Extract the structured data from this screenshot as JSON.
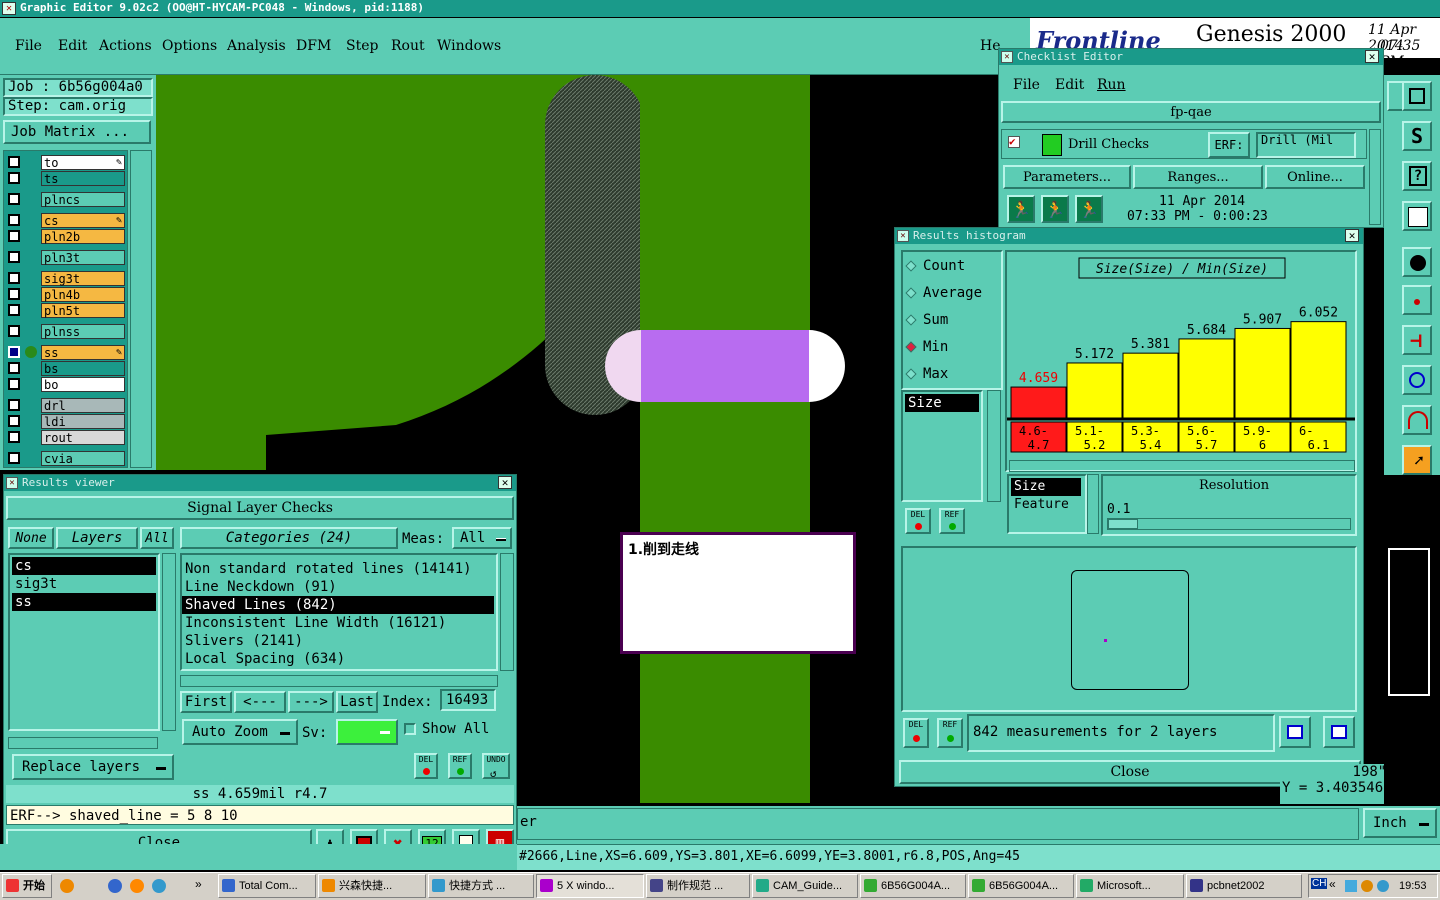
{
  "app_title": "Graphic Editor 9.02c2 (OO@HT-HYCAM-PC048 - Windows, pid:1188)",
  "menu": [
    "File",
    "Edit",
    "Actions",
    "Options",
    "Analysis",
    "DFM",
    "Step",
    "Rout",
    "Windows"
  ],
  "help_label": "He",
  "brand": {
    "logo": "Frontline",
    "product": "Genesis 2000",
    "date": "11 Apr 2014",
    "time": "07:35 PM"
  },
  "job": {
    "job_label": "Job : 6b56g004a0",
    "step_label": "Step: cam.orig",
    "matrix_button": "Job Matrix ..."
  },
  "layers": [
    {
      "name": "to",
      "color": "#ffffff",
      "mark": true
    },
    {
      "name": "ts",
      "color": "#1a9a8a",
      "mark": false
    },
    {
      "name": "plncs",
      "color": "#5cccb4",
      "mark": false
    },
    {
      "name": "cs",
      "color": "#f5b842",
      "mark": true
    },
    {
      "name": "pln2b",
      "color": "#f5b842",
      "mark": false
    },
    {
      "name": "pln3t",
      "color": "#5cccb4",
      "mark": false
    },
    {
      "name": "sig3t",
      "color": "#f5b842",
      "mark": false
    },
    {
      "name": "pln4b",
      "color": "#f5b842",
      "mark": false
    },
    {
      "name": "pln5t",
      "color": "#f5b842",
      "mark": false
    },
    {
      "name": "plnss",
      "color": "#5cccb4",
      "mark": false
    },
    {
      "name": "ss",
      "color": "#f5b842",
      "mark": true
    },
    {
      "name": "bs",
      "color": "#1a9a8a",
      "mark": false
    },
    {
      "name": "bo",
      "color": "#ffffff",
      "mark": false
    },
    {
      "name": "drl",
      "color": "#a8b8b8",
      "mark": false
    },
    {
      "name": "ldi",
      "color": "#a8b8b8",
      "mark": false
    },
    {
      "name": "rout",
      "color": "#d8d8d8",
      "mark": false
    },
    {
      "name": "cvia",
      "color": "#5cccb4",
      "mark": false
    }
  ],
  "annotation": "1.削到走线",
  "results_viewer": {
    "title": "Results viewer",
    "header": "Signal Layer Checks",
    "none_btn": "None",
    "layers_btn": "Layers",
    "all_btn": "All",
    "categories_btn": "Categories (24)",
    "meas_label": "Meas:",
    "meas_value": "All",
    "layer_list": [
      "cs",
      "sig3t",
      "ss"
    ],
    "categories": [
      "Non standard rotated lines (14141)",
      "Line Neckdown (91)",
      "Shaved Lines (842)",
      "Inconsistent Line Width (16121)",
      "Slivers (2141)",
      "Local Spacing (634)"
    ],
    "first_btn": "First",
    "prev_btn": "<---",
    "next_btn": "--->",
    "last_btn": "Last",
    "index_label": "Index:",
    "index_value": "16493",
    "auto_zoom": "Auto Zoom",
    "sv_label": "Sv:",
    "show_all": "Show All",
    "replace_layers": "Replace layers",
    "del": "DEL",
    "ref": "REF",
    "undo": "UNDO",
    "status": "ss 4.659mil  r4.7",
    "erf": "ERF--> shaved_line = 5 8 10",
    "close": "Close"
  },
  "checklist": {
    "title": "Checklist Editor",
    "menu": [
      "File",
      "Edit",
      "Run"
    ],
    "name": "fp-qae",
    "check": "Drill Checks",
    "erf_label": "ERF:",
    "erf_value": "Drill (Mil",
    "params": "Parameters...",
    "ranges": "Ranges...",
    "online": "Online...",
    "date": "11 Apr 2014",
    "time": "07:33 PM - 0:00:23"
  },
  "histogram": {
    "title": "Results histogram",
    "modes": [
      "Count",
      "Average",
      "Sum",
      "Min",
      "Max"
    ],
    "selected_mode": "Min",
    "attr_list": [
      "Size"
    ],
    "size_label": "Size",
    "feature_label": "Feature",
    "resolution_label": "Resolution",
    "resolution_value": "0.1",
    "measurements": "842 measurements for 2 layers",
    "close": "Close",
    "del": "DEL",
    "ref": "REF"
  },
  "chart_data": {
    "type": "bar",
    "title": "Size(Size) / Min(Size)",
    "categories": [
      "4.6-4.7",
      "5.1-5.2",
      "5.3-5.4",
      "5.6-5.7",
      "5.9-6",
      "6-6.1"
    ],
    "category_labels": [
      [
        "4.6-",
        "4.7"
      ],
      [
        "5.1-",
        "5.2"
      ],
      [
        "5.3-",
        "5.4"
      ],
      [
        "5.6-",
        "5.7"
      ],
      [
        "5.9-",
        "6"
      ],
      [
        "6-",
        "6.1"
      ]
    ],
    "values": [
      4.659,
      5.172,
      5.381,
      5.684,
      5.907,
      6.052
    ],
    "value_labels": [
      "4.659",
      "5.172",
      "5.381",
      "5.684",
      "5.907",
      "6.052"
    ],
    "colors": [
      "#ff1a1a",
      "#ffff00",
      "#ffff00",
      "#ffff00",
      "#ffff00",
      "#ffff00"
    ],
    "ylim": [
      4.0,
      6.3
    ]
  },
  "coords": {
    "x": "198\"",
    "y": "Y = 3.403546\""
  },
  "units": "Inch",
  "er_label": "er",
  "feature_info": "#2666,Line,XS=6.609,YS=3.801,XE=6.6099,YE=3.8001,r6.8,POS,Ang=45",
  "taskbar": {
    "start": "开始",
    "items": [
      "Total Com...",
      "兴森快捷...",
      "快捷方式 ...",
      "5 X windo...",
      "制作规范 ...",
      "CAM_Guide...",
      "6B56G004A...",
      "6B56G004A...",
      "Microsoft...",
      "pcbnet2002"
    ],
    "clock": "19:53",
    "tray_ch": "CH"
  }
}
